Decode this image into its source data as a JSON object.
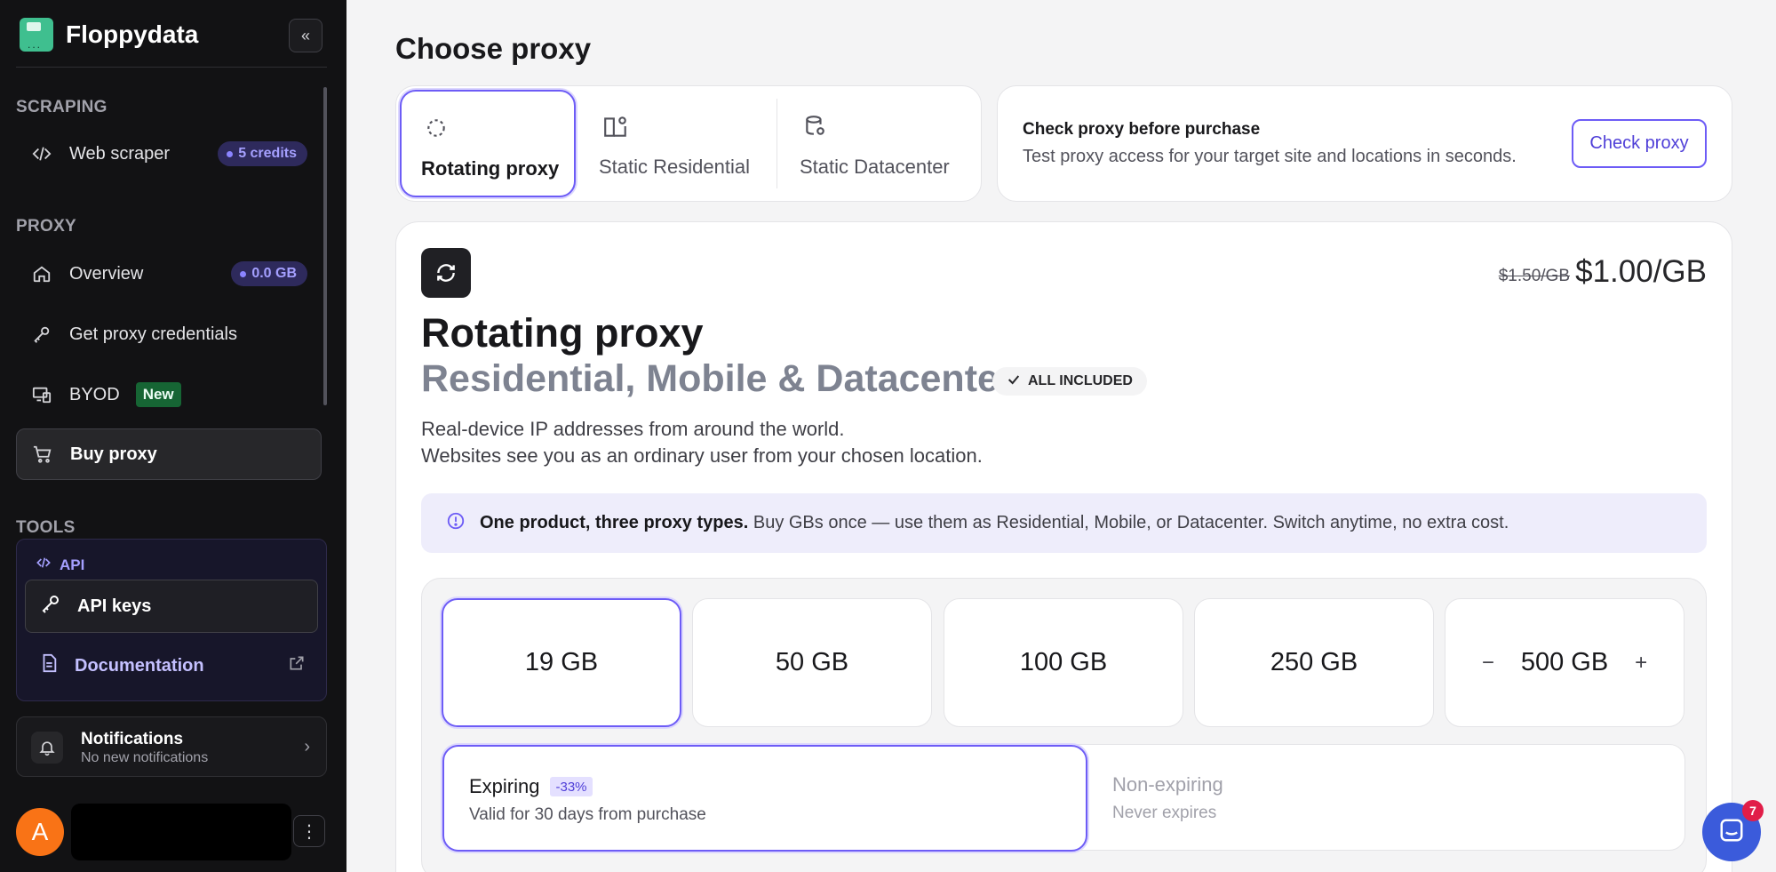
{
  "brand": {
    "name": "Floppydata"
  },
  "sidebar": {
    "sections": {
      "scraping": "SCRAPING",
      "proxy": "PROXY",
      "tools": "TOOLS"
    },
    "web_scraper": {
      "label": "Web scraper",
      "badge": "5 credits"
    },
    "overview": {
      "label": "Overview",
      "badge": "0.0 GB"
    },
    "credentials": {
      "label": "Get proxy credentials"
    },
    "byod": {
      "label": "BYOD",
      "badge": "New"
    },
    "buy_proxy": {
      "label": "Buy proxy"
    },
    "api": {
      "heading": "API",
      "api_keys": "API keys",
      "documentation": "Documentation"
    },
    "notifications": {
      "title": "Notifications",
      "subtitle": "No new notifications"
    },
    "user": {
      "initial": "A"
    }
  },
  "main": {
    "title": "Choose proxy",
    "tabs": [
      {
        "label": "Rotating proxy"
      },
      {
        "label": "Static Residential"
      },
      {
        "label": "Static Datacenter"
      }
    ],
    "check": {
      "title": "Check proxy before purchase",
      "description": "Test proxy access for your target site and locations in seconds.",
      "button": "Check proxy"
    },
    "product": {
      "old_price": "$1.50/GB",
      "price": "$1.00/GB",
      "title": "Rotating proxy",
      "subtitle": "Residential, Mobile & Datacenter",
      "badge": "ALL INCLUDED",
      "desc_line1": "Real-device IP addresses from around the world.",
      "desc_line2": "Websites see you as an ordinary user from your chosen location.",
      "info_bold": "One product, three proxy types.",
      "info_text": "Buy GBs once — use them as Residential, Mobile, or Datacenter. Switch anytime, no extra cost.",
      "sizes": [
        "19 GB",
        "50 GB",
        "100 GB",
        "250 GB",
        "500 GB"
      ],
      "stepper": {
        "minus": "−",
        "plus": "+"
      },
      "expiring": {
        "title": "Expiring",
        "discount": "-33%",
        "sub": "Valid for 30 days from purchase"
      },
      "non_expiring": {
        "title": "Non-expiring",
        "sub": "Never expires"
      }
    }
  },
  "chat": {
    "unread": "7"
  },
  "colors": {
    "accent": "#6d5cf6",
    "sidebar_bg": "#121214",
    "brand": "#3fbf8f",
    "avatar": "#f97316"
  }
}
